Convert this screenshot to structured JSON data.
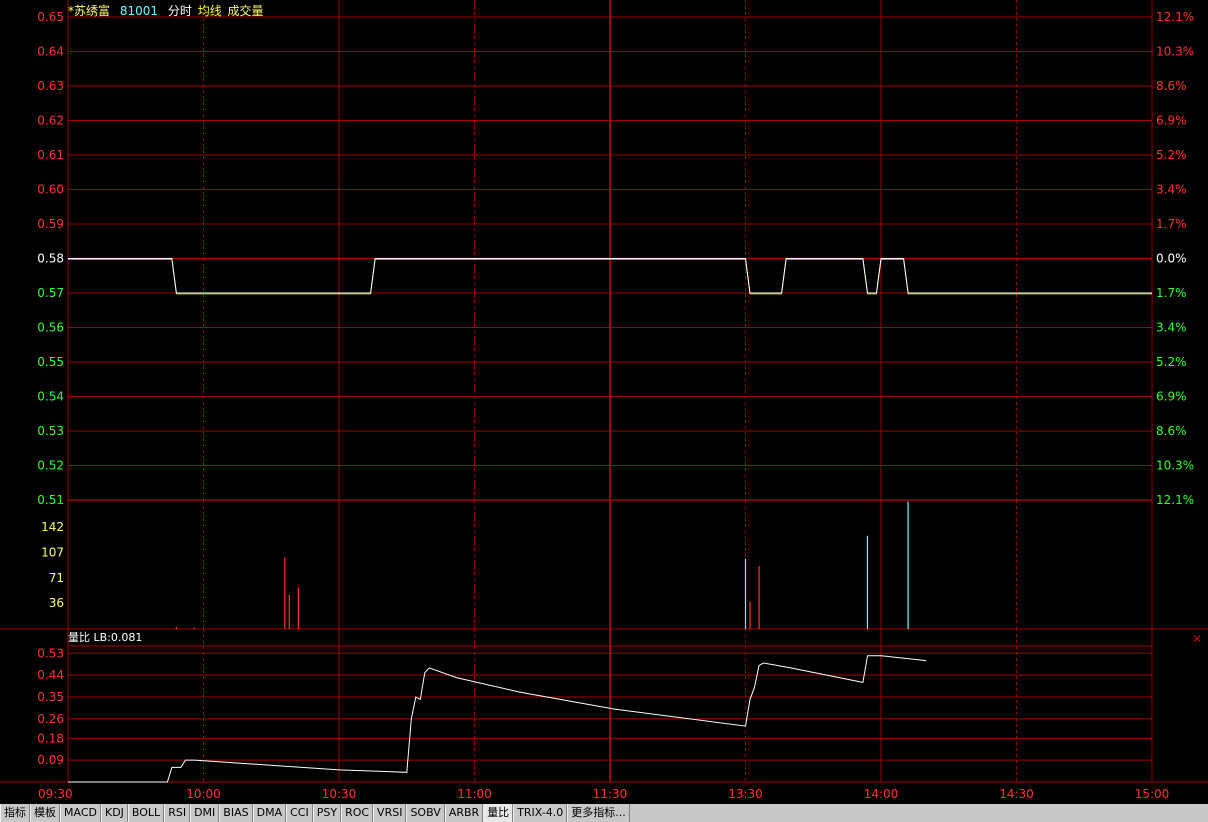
{
  "header": {
    "stock_name": "*苏绣富",
    "stock_code": "81001",
    "legend_timeshare": "分时",
    "legend_avg": "均线",
    "legend_volume": "成交量"
  },
  "sub_header": {
    "label": "量比",
    "lb_text": "LB:0.081"
  },
  "colors": {
    "up": "#ff3333",
    "down": "#33ff33",
    "neutral": "#ffffff",
    "grid": "#a00000",
    "volume_label": "#ffff66",
    "price_line": "#ffffff",
    "avg_line": "#ffff00",
    "cyan": "#66ffff"
  },
  "toolbar": {
    "items": [
      "指标",
      "模板",
      "MACD",
      "KDJ",
      "BOLL",
      "RSI",
      "DMI",
      "BIAS",
      "DMA",
      "CCI",
      "PSY",
      "ROC",
      "VRSI",
      "SOBV",
      "ARBR",
      "量比",
      "TRIX-4.0",
      "更多指标..."
    ],
    "active": "量比"
  },
  "chart_data": [
    {
      "type": "line",
      "name": "price",
      "x_labels": [
        "09:30",
        "10:00",
        "10:30",
        "11:00",
        "11:30",
        "13:30",
        "14:00",
        "14:30",
        "15:00"
      ],
      "y_left_ticks": [
        "0.65",
        "0.64",
        "0.63",
        "0.62",
        "0.61",
        "0.60",
        "0.59",
        "0.58",
        "0.57",
        "0.56",
        "0.55",
        "0.54",
        "0.53",
        "0.52",
        "0.51"
      ],
      "y_right_ticks": [
        "12.1%",
        "10.3%",
        "8.6%",
        "6.9%",
        "5.2%",
        "3.4%",
        "1.7%",
        "0.0%",
        "1.7%",
        "3.4%",
        "5.2%",
        "6.9%",
        "8.6%",
        "10.3%",
        "12.1%"
      ],
      "ylim": [
        0.51,
        0.65
      ],
      "prev_close": 0.58,
      "series": [
        {
          "values": [
            [
              0,
              0.58
            ],
            [
              23,
              0.58
            ],
            [
              24,
              0.57
            ],
            [
              67,
              0.57
            ],
            [
              68,
              0.58
            ],
            [
              150,
              0.58
            ],
            [
              151,
              0.57
            ],
            [
              158,
              0.57
            ],
            [
              159,
              0.58
            ],
            [
              176,
              0.58
            ],
            [
              177,
              0.57
            ],
            [
              179,
              0.57
            ],
            [
              180,
              0.58
            ],
            [
              185,
              0.58
            ],
            [
              186,
              0.57
            ],
            [
              240,
              0.57
            ]
          ]
        }
      ]
    },
    {
      "type": "bar",
      "name": "volume",
      "y_ticks": [
        "142",
        "107",
        "71",
        "36"
      ],
      "ylim": [
        0,
        180
      ],
      "bars": [
        {
          "t": 24,
          "v": 3,
          "color": "up"
        },
        {
          "t": 28,
          "v": 2,
          "color": "up"
        },
        {
          "t": 48,
          "v": 100,
          "color": "up"
        },
        {
          "t": 49,
          "v": 48,
          "color": "up"
        },
        {
          "t": 51,
          "v": 58,
          "color": "up"
        },
        {
          "t": 150,
          "v": 98,
          "color": "cyan"
        },
        {
          "t": 151,
          "v": 38,
          "color": "up"
        },
        {
          "t": 153,
          "v": 88,
          "color": "up"
        },
        {
          "t": 177,
          "v": 130,
          "color": "cyan"
        },
        {
          "t": 186,
          "v": 178,
          "color": "cyan"
        }
      ]
    },
    {
      "type": "line",
      "name": "量比",
      "y_ticks": [
        "0.53",
        "0.44",
        "0.35",
        "0.26",
        "0.18",
        "0.09"
      ],
      "ylim": [
        0,
        0.56
      ],
      "series": [
        {
          "values": [
            [
              0,
              0.0
            ],
            [
              22,
              0.0
            ],
            [
              23,
              0.06
            ],
            [
              25,
              0.06
            ],
            [
              26,
              0.09
            ],
            [
              28,
              0.09
            ],
            [
              60,
              0.05
            ],
            [
              75,
              0.04
            ],
            [
              76,
              0.26
            ],
            [
              77,
              0.35
            ],
            [
              78,
              0.34
            ],
            [
              79,
              0.45
            ],
            [
              80,
              0.47
            ],
            [
              86,
              0.43
            ],
            [
              100,
              0.37
            ],
            [
              121,
              0.3
            ],
            [
              150,
              0.23
            ],
            [
              151,
              0.34
            ],
            [
              152,
              0.39
            ],
            [
              153,
              0.48
            ],
            [
              154,
              0.49
            ],
            [
              160,
              0.47
            ],
            [
              176,
              0.41
            ],
            [
              177,
              0.52
            ],
            [
              180,
              0.52
            ],
            [
              190,
              0.5
            ]
          ]
        }
      ]
    }
  ]
}
